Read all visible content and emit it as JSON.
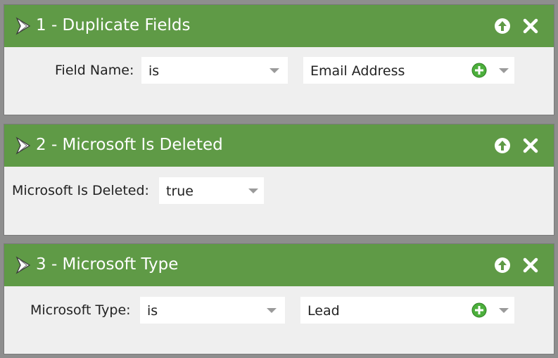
{
  "filters": [
    {
      "title": "1 - Duplicate Fields",
      "label": "Field Name:",
      "operator": "is",
      "value": "Email Address"
    },
    {
      "title": "2 - Microsoft Is Deleted",
      "label": "Microsoft Is Deleted:",
      "operator": "true"
    },
    {
      "title": "3 - Microsoft Type",
      "label": "Microsoft Type:",
      "operator": "is",
      "value": "Lead"
    }
  ],
  "colors": {
    "header_green": "#5f9a46",
    "panel_bg": "#efefef",
    "add_icon_green": "#4caf3c"
  },
  "icons": {
    "header_left": "funnel-icon",
    "move_up": "move-up-icon",
    "remove": "close-icon",
    "add": "plus-circle-icon",
    "dropdown": "chevron-down-icon"
  }
}
